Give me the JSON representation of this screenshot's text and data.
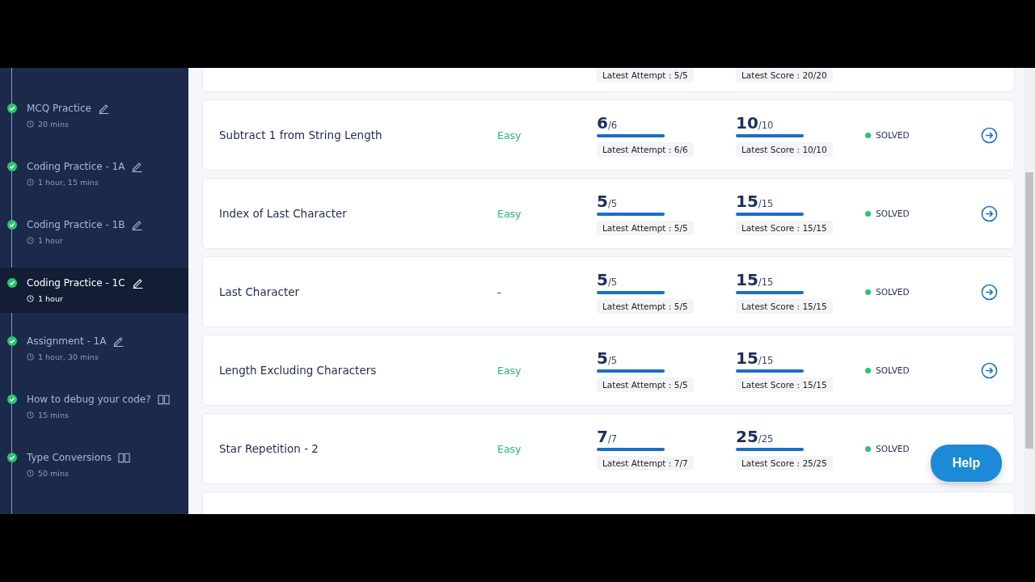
{
  "sidebar": {
    "items": [
      {
        "title": "MCQ Practice",
        "kind": "edit",
        "duration": "20 mins",
        "completed": true,
        "selected": false
      },
      {
        "title": "Coding Practice - 1A",
        "kind": "edit",
        "duration": "1 hour, 15 mins",
        "completed": true,
        "selected": false
      },
      {
        "title": "Coding Practice - 1B",
        "kind": "edit",
        "duration": "1 hour",
        "completed": true,
        "selected": false
      },
      {
        "title": "Coding Practice - 1C",
        "kind": "edit",
        "duration": "1 hour",
        "completed": true,
        "selected": true
      },
      {
        "title": "Assignment - 1A",
        "kind": "edit",
        "duration": "1 hour, 30 mins",
        "completed": true,
        "selected": false
      },
      {
        "title": "How to debug your code?",
        "kind": "reading",
        "duration": "15 mins",
        "completed": true,
        "selected": false
      },
      {
        "title": "Type Conversions",
        "kind": "reading",
        "duration": "50 mins",
        "completed": true,
        "selected": false
      }
    ]
  },
  "questions": [
    {
      "kind": "partial",
      "attempt_chip": "Latest Attempt : 5/5",
      "score_chip": "Latest Score : 20/20"
    },
    {
      "kind": "full",
      "title": "Subtract 1 from String Length",
      "difficulty": "Easy",
      "attempt": "6",
      "attempt_total": "/6",
      "attempt_bar": {
        "level": 1
      },
      "attempt_chip": "Latest Attempt : 6/6",
      "score": "10",
      "score_total": "/10",
      "score_bar": {
        "level": 1
      },
      "score_chip": "Latest Score : 10/10",
      "status": "SOLVED"
    },
    {
      "kind": "full",
      "title": "Index of Last Character",
      "difficulty": "Easy",
      "attempt": "5",
      "attempt_total": "/5",
      "attempt_bar": {
        "level": 1
      },
      "attempt_chip": "Latest Attempt : 5/5",
      "score": "15",
      "score_total": "/15",
      "score_bar": {
        "level": 1
      },
      "score_chip": "Latest Score : 15/15",
      "status": "SOLVED"
    },
    {
      "kind": "full",
      "title": "Last Character",
      "difficulty": "-",
      "attempt": "5",
      "attempt_total": "/5",
      "attempt_bar": {
        "level": 1
      },
      "attempt_chip": "Latest Attempt : 5/5",
      "score": "15",
      "score_total": "/15",
      "score_bar": {
        "level": 1
      },
      "score_chip": "Latest Score : 15/15",
      "status": "SOLVED"
    },
    {
      "kind": "full",
      "title": "Length Excluding Characters",
      "difficulty": "Easy",
      "attempt": "5",
      "attempt_total": "/5",
      "attempt_bar": {
        "level": 1
      },
      "attempt_chip": "Latest Attempt : 5/5",
      "score": "15",
      "score_total": "/15",
      "score_bar": {
        "level": 1
      },
      "score_chip": "Latest Score : 15/15",
      "status": "SOLVED"
    },
    {
      "kind": "full",
      "title": "Star Repetition - 2",
      "difficulty": "Easy",
      "attempt": "7",
      "attempt_total": "/7",
      "attempt_bar": {
        "level": 1
      },
      "attempt_chip": "Latest Attempt : 7/7",
      "score": "25",
      "score_total": "/25",
      "score_bar": {
        "level": 1
      },
      "score_chip": "Latest Score : 25/25",
      "status": "SOLVED",
      "arrow_hidden": true
    },
    {
      "kind": "empty"
    }
  ],
  "help_button": "Help"
}
